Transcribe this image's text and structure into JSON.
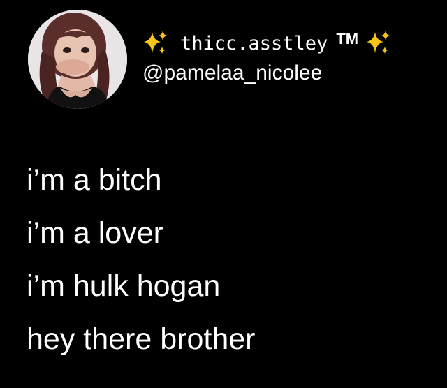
{
  "account": {
    "display_name": "thicc.asstley",
    "trademark": "TM",
    "handle": "@pamelaa_nicolee",
    "avatar_icon": "profile-photo",
    "name_emoji": "sparkles-icon",
    "sparkle_color": "#f5c518"
  },
  "tweet": {
    "lines": [
      "i’m a bitch",
      "i’m a lover",
      "i’m hulk hogan",
      "hey there brother"
    ]
  },
  "colors": {
    "background": "#000000",
    "text": "#ffffff"
  }
}
